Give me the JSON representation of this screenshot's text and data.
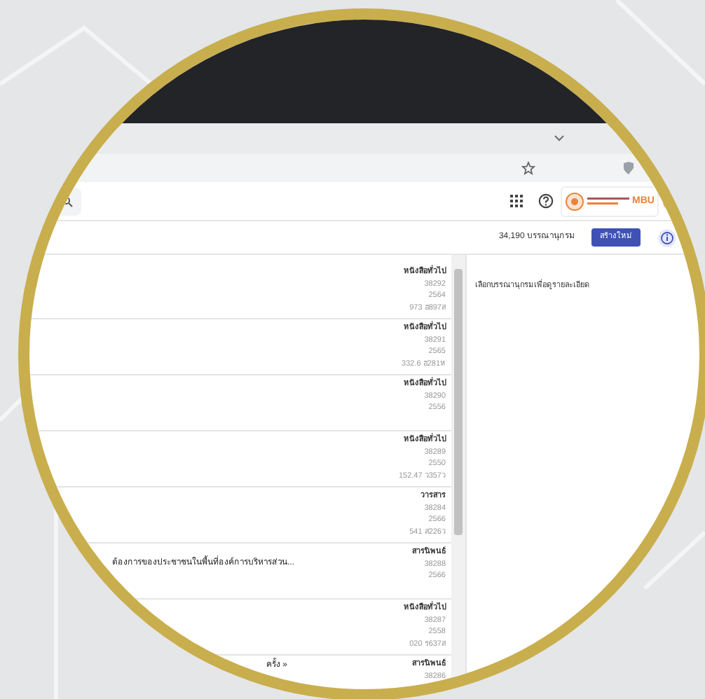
{
  "header": {
    "logo_text": "MBU"
  },
  "toolbar": {
    "count": "34,190 บรรณานุกรม",
    "create_button": "สร้างใหม่"
  },
  "records": [
    {
      "type": "หนังสือทั่วไป",
      "id": "38292",
      "year": "2564",
      "call_number": "973 ฮ897ส"
    },
    {
      "type": "หนังสือทั่วไป",
      "id": "38291",
      "year": "2565",
      "call_number": "332.6 ฮ281ห"
    },
    {
      "type": "หนังสือทั่วไป",
      "id": "38290",
      "year": "2556"
    },
    {
      "type": "หนังสือทั่วไป",
      "id": "38289",
      "year": "2550",
      "call_number": "152.47 ว357ว"
    },
    {
      "type": "วารสาร",
      "id": "38284",
      "year": "2566",
      "call_number": "541 ส226ว"
    },
    {
      "title": "ต้องการของประชาชนในพื้นที่องค์การบริหารส่วน...",
      "type": "สารนิพนธ์",
      "id": "38288",
      "year": "2566"
    },
    {
      "type": "หนังสือทั่วไป",
      "id": "38287",
      "year": "2558",
      "call_number": "020 ร637ส"
    },
    {
      "title": "ครั้ง »",
      "type": "สารนิพนธ์",
      "id": "38286"
    }
  ],
  "detail_panel": {
    "hint": "เลือกบรรณานุกรมเพื่อดูรายละเอียด"
  }
}
